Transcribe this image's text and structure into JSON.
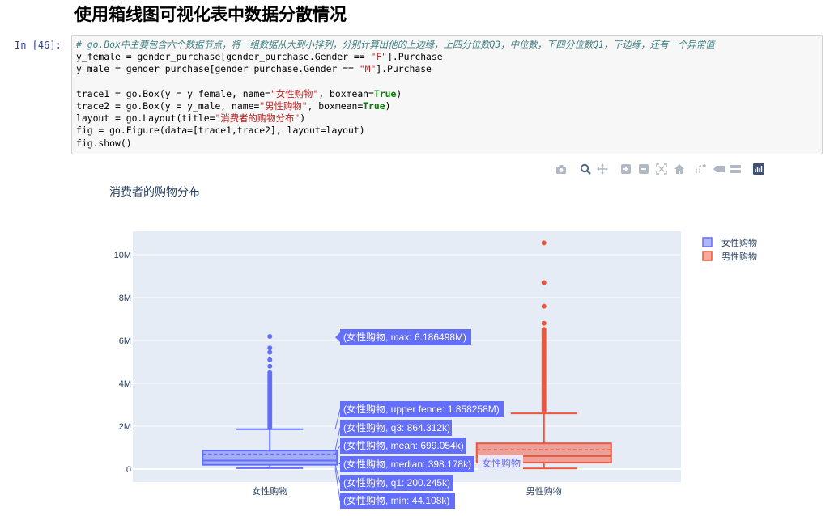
{
  "notebook": {
    "heading": "使用箱线图可视化表中数据分散情况",
    "prompt": "In [46]:",
    "code": [
      [
        {
          "t": "# go.Box中主要包含六个数据节点，将一组数据从大到小排列，分别计算出他的上边缘，上四分位数Q3，中位数，下四分位数Q1，下边缘，还有一个异常值",
          "c": "c-comment"
        }
      ],
      [
        {
          "t": "y_female = gender_purchase[gender_purchase.Gender == "
        },
        {
          "t": "\"F\"",
          "c": "c-str"
        },
        {
          "t": "].Purchase"
        }
      ],
      [
        {
          "t": "y_male = gender_purchase[gender_purchase.Gender == "
        },
        {
          "t": "\"M\"",
          "c": "c-str"
        },
        {
          "t": "].Purchase"
        }
      ],
      [
        {
          "t": ""
        }
      ],
      [
        {
          "t": "trace1 = go.Box(y = y_female, name="
        },
        {
          "t": "\"女性购物\"",
          "c": "c-str"
        },
        {
          "t": ", boxmean="
        },
        {
          "t": "True",
          "c": "c-kw"
        },
        {
          "t": ")"
        }
      ],
      [
        {
          "t": "trace2 = go.Box(y = y_male, name="
        },
        {
          "t": "\"男性购物\"",
          "c": "c-str"
        },
        {
          "t": ", boxmean="
        },
        {
          "t": "True",
          "c": "c-kw"
        },
        {
          "t": ")"
        }
      ],
      [
        {
          "t": "layout = go.Layout(title="
        },
        {
          "t": "\"消费者的购物分布\"",
          "c": "c-str"
        },
        {
          "t": ")"
        }
      ],
      [
        {
          "t": "fig = go.Figure(data=[trace1,trace2], layout=layout)"
        }
      ],
      [
        {
          "t": "fig.show()"
        }
      ]
    ]
  },
  "modebar": {
    "buttons": [
      "camera-icon",
      "zoom-icon",
      "pan-icon",
      "zoom-in-icon",
      "zoom-out-icon",
      "autoscale-icon",
      "reset-axes-icon",
      "spike-lines-icon",
      "hover-closest-icon",
      "hover-compare-icon",
      "plotly-logo-icon"
    ]
  },
  "chart_data": {
    "type": "box",
    "title": "消费者的购物分布",
    "xlabel": "",
    "ylabel": "",
    "categories": [
      "女性购物",
      "男性购物"
    ],
    "ylim": [
      -500000,
      11000000
    ],
    "yticks": [
      0,
      2000000,
      4000000,
      6000000,
      8000000,
      10000000
    ],
    "ytick_labels": [
      "0",
      "2M",
      "4M",
      "6M",
      "8M",
      "10M"
    ],
    "grid": true,
    "legend_position": "top-right",
    "series": [
      {
        "name": "女性购物",
        "color": "#636efa",
        "min": 44108,
        "q1": 200245,
        "median": 398178,
        "mean": 699054,
        "q3": 864312,
        "upper_fence": 1858258,
        "max": 6186498,
        "outliers": [
          1920000,
          2000000,
          2080000,
          2160000,
          2240000,
          2320000,
          2400000,
          2480000,
          2560000,
          2640000,
          2720000,
          2800000,
          2880000,
          2960000,
          3040000,
          3120000,
          3200000,
          3280000,
          3360000,
          3440000,
          3520000,
          3600000,
          3680000,
          3760000,
          3840000,
          3920000,
          4000000,
          4080000,
          4160000,
          4240000,
          4320000,
          4400000,
          4500000,
          4800000,
          5100000,
          5450000,
          5650000,
          6186498
        ]
      },
      {
        "name": "男性购物",
        "color": "#ef553b",
        "min": 30000,
        "q1": 300000,
        "median": 610000,
        "mean": 900000,
        "q3": 1200000,
        "upper_fence": 2600000,
        "max": 10550000,
        "outliers": [
          2680000,
          2760000,
          2840000,
          2920000,
          3000000,
          3080000,
          3160000,
          3240000,
          3320000,
          3400000,
          3480000,
          3560000,
          3640000,
          3720000,
          3800000,
          3880000,
          3960000,
          4040000,
          4120000,
          4200000,
          4280000,
          4360000,
          4440000,
          4520000,
          4600000,
          4680000,
          4760000,
          4840000,
          4920000,
          5000000,
          5080000,
          5160000,
          5240000,
          5320000,
          5400000,
          5480000,
          5560000,
          5640000,
          5720000,
          5800000,
          5880000,
          5960000,
          6040000,
          6120000,
          6200000,
          6280000,
          6360000,
          6440000,
          6520000,
          6800000,
          7600000,
          8700000,
          10550000
        ]
      }
    ],
    "hover_labels": [
      "(女性购物, max: 6.186498M)",
      "(女性购物, upper fence: 1.858258M)",
      "(女性购物, q3: 864.312k)",
      "(女性购物, mean: 699.054k)",
      "(女性购物, median: 398.178k)",
      "(女性购物, q1: 200.245k)",
      "(女性购物, min: 44.108k)"
    ],
    "hover_x_label": "女性购物"
  }
}
